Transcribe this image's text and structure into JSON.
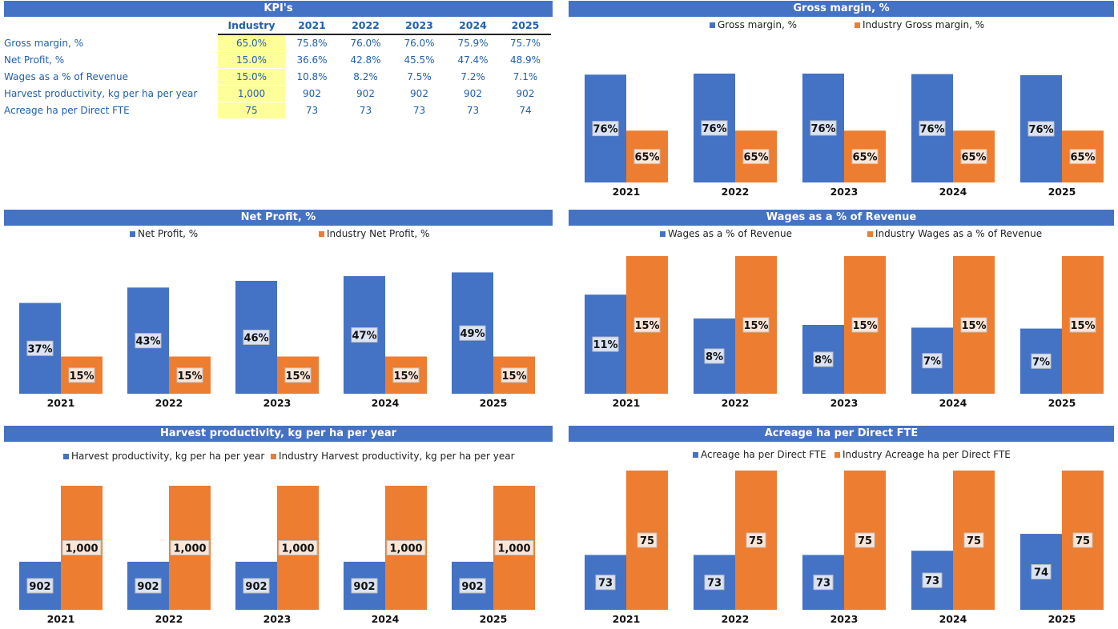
{
  "colors": {
    "banner": "#4472C4",
    "company": "#4472C4",
    "industry": "#ED7D31",
    "industry_cell": "#FFFF99",
    "table_text": "#1F5FAF"
  },
  "kpi": {
    "title": "KPI's",
    "columns": [
      "Industry",
      "2021",
      "2022",
      "2023",
      "2024",
      "2025"
    ],
    "rows": [
      {
        "label": "Gross margin, %",
        "industry": "65.0%",
        "values": [
          "75.8%",
          "76.0%",
          "76.0%",
          "75.9%",
          "75.7%"
        ]
      },
      {
        "label": "Net Profit, %",
        "industry": "15.0%",
        "values": [
          "36.6%",
          "42.8%",
          "45.5%",
          "47.4%",
          "48.9%"
        ]
      },
      {
        "label": "Wages as a % of Revenue",
        "industry": "15.0%",
        "values": [
          "10.8%",
          "8.2%",
          "7.5%",
          "7.2%",
          "7.1%"
        ]
      },
      {
        "label": "Harvest productivity, kg per ha per year",
        "industry": "1,000",
        "values": [
          "902",
          "902",
          "902",
          "902",
          "902"
        ]
      },
      {
        "label": "Acreage ha per Direct FTE",
        "industry": "75",
        "values": [
          "73",
          "73",
          "73",
          "73",
          "74"
        ]
      }
    ]
  },
  "chart_data": [
    {
      "id": "gross",
      "type": "bar",
      "title": "Gross margin, %",
      "categories": [
        "2021",
        "2022",
        "2023",
        "2024",
        "2025"
      ],
      "series": [
        {
          "name": "Gross margin, %",
          "values": [
            0.758,
            0.76,
            0.76,
            0.759,
            0.757
          ],
          "labels": [
            "76%",
            "76%",
            "76%",
            "76%",
            "76%"
          ]
        },
        {
          "name": "Industry Gross margin, %",
          "values": [
            0.65,
            0.65,
            0.65,
            0.65,
            0.65
          ],
          "labels": [
            "65%",
            "65%",
            "65%",
            "65%",
            "65%"
          ]
        }
      ],
      "ylim": [
        0.55,
        0.78
      ],
      "legend": "top",
      "grid": false
    },
    {
      "id": "net",
      "type": "bar",
      "title": "Net Profit, %",
      "categories": [
        "2021",
        "2022",
        "2023",
        "2024",
        "2025"
      ],
      "series": [
        {
          "name": "Net Profit, %",
          "values": [
            0.366,
            0.428,
            0.455,
            0.474,
            0.489
          ],
          "labels": [
            "37%",
            "43%",
            "46%",
            "47%",
            "49%"
          ]
        },
        {
          "name": "Industry Net Profit, %",
          "values": [
            0.15,
            0.15,
            0.15,
            0.15,
            0.15
          ],
          "labels": [
            "15%",
            "15%",
            "15%",
            "15%",
            "15%"
          ]
        }
      ],
      "ylim": [
        0,
        0.5
      ],
      "legend": "top",
      "grid": false
    },
    {
      "id": "wages",
      "type": "bar",
      "title": "Wages as a % of Revenue",
      "categories": [
        "2021",
        "2022",
        "2023",
        "2024",
        "2025"
      ],
      "series": [
        {
          "name": "Wages as a % of Revenue",
          "values": [
            0.108,
            0.082,
            0.075,
            0.072,
            0.071
          ],
          "labels": [
            "11%",
            "8%",
            "8%",
            "7%",
            "7%"
          ]
        },
        {
          "name": "Industry Wages as a % of Revenue",
          "values": [
            0.15,
            0.15,
            0.15,
            0.15,
            0.15
          ],
          "labels": [
            "15%",
            "15%",
            "15%",
            "15%",
            "15%"
          ]
        }
      ],
      "ylim": [
        0,
        0.15
      ],
      "legend": "top",
      "grid": false
    },
    {
      "id": "harvest",
      "type": "bar",
      "title": "Harvest productivity, kg per ha per year",
      "categories": [
        "2021",
        "2022",
        "2023",
        "2024",
        "2025"
      ],
      "series": [
        {
          "name": "Harvest productivity, kg per ha per year",
          "values": [
            902,
            902,
            902,
            902,
            902
          ],
          "labels": [
            "902",
            "902",
            "902",
            "902",
            "902"
          ]
        },
        {
          "name": "Industry Harvest productivity, kg per ha per year",
          "values": [
            1000,
            1000,
            1000,
            1000,
            1000
          ],
          "labels": [
            "1,000",
            "1,000",
            "1,000",
            "1,000",
            "1,000"
          ]
        }
      ],
      "ylim": [
        840,
        1000
      ],
      "legend": "top",
      "grid": false
    },
    {
      "id": "acreage",
      "type": "bar",
      "title": "Acreage ha per Direct FTE",
      "categories": [
        "2021",
        "2022",
        "2023",
        "2024",
        "2025"
      ],
      "series": [
        {
          "name": "Acreage ha per Direct FTE",
          "values": [
            73.0,
            73.0,
            73.0,
            73.1,
            73.5
          ],
          "labels": [
            "73",
            "73",
            "73",
            "73",
            "74"
          ]
        },
        {
          "name": "Industry Acreage ha per Direct FTE",
          "values": [
            75,
            75,
            75,
            75,
            75
          ],
          "labels": [
            "75",
            "75",
            "75",
            "75",
            "75"
          ]
        }
      ],
      "ylim": [
        71.7,
        75
      ],
      "legend": "top",
      "grid": false
    }
  ]
}
